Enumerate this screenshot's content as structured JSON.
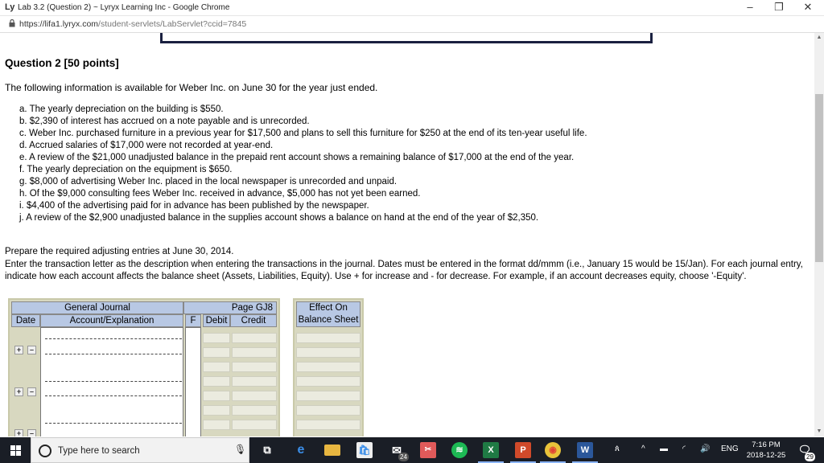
{
  "window": {
    "title": "Lab 3.2 (Question 2) ~ Lyryx Learning Inc - Google Chrome",
    "logo": "Ly",
    "minimize": "–",
    "restore": "❐",
    "close": "✕"
  },
  "address": {
    "lock_icon": "lock-icon",
    "url_host": "https://lifa1.lyryx.com",
    "url_path": "/student-servlets/LabServlet?ccid=7845"
  },
  "question": {
    "title": "Question 2 [50 points]",
    "intro": "The following information is available for Weber Inc. on June 30 for the year just ended.",
    "items": [
      "a. The yearly depreciation on the building is $550.",
      "b. $2,390 of interest has accrued on a note payable and is unrecorded.",
      "c. Weber Inc. purchased furniture in a previous year for $17,500 and plans to sell this furniture for $250 at the end of its ten-year useful life.",
      "d. Accrued salaries of $17,000 were not recorded at year-end.",
      "e. A review of the $21,000 unadjusted balance in the prepaid rent account shows a remaining balance of $17,000 at the end of the year.",
      "f. The yearly depreciation on the equipment is $650.",
      "g. $8,000 of advertising Weber Inc. placed in the local newspaper is unrecorded and unpaid.",
      "h. Of the $9,000 consulting fees Weber Inc. received in advance, $5,000 has not yet been earned.",
      "i. $4,400 of the advertising paid for in advance has been published by the newspaper.",
      "j. A review of the $2,900 unadjusted balance in the supplies account shows a balance on hand at the end of the year of $2,350."
    ],
    "prepare": "Prepare the required adjusting entries at June 30, 2014.",
    "instructions": "Enter the transaction letter as the description when entering the transactions in the journal. Dates must be entered in the format dd/mmm (i.e., January 15 would be 15/Jan). For each journal entry, indicate how each account affects the balance sheet (Assets, Liabilities, Equity). Use + for increase and - for decrease. For example, if an account decreases equity, choose '-Equity'."
  },
  "journal": {
    "title": "General Journal",
    "page": "Page GJ8",
    "columns": {
      "date": "Date",
      "account": "Account/Explanation",
      "f": "F",
      "debit": "Debit",
      "credit": "Credit"
    },
    "add_symbol": "+",
    "remove_symbol": "–"
  },
  "effect": {
    "line1": "Effect On",
    "line2": "Balance Sheet"
  },
  "taskbar": {
    "search_placeholder": "Type here to search",
    "excel": "X",
    "powerpoint": "P",
    "word": "W",
    "mail_badge": "24",
    "lang": "ENG",
    "time": "7:16 PM",
    "date": "2018-12-25",
    "notif_badge": "29"
  }
}
